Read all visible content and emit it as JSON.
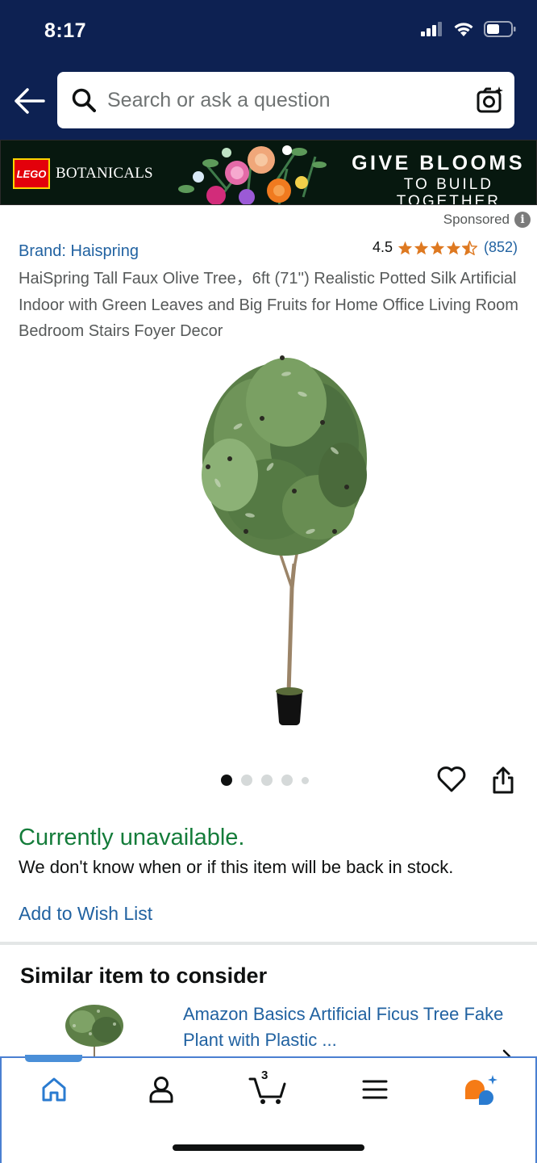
{
  "status_bar": {
    "time": "8:17"
  },
  "header": {
    "search_placeholder": "Search or ask a question"
  },
  "banner": {
    "logo_text": "LEGO",
    "brand": "BOTANICALS",
    "headline": "GIVE BLOOMS",
    "subline_1": "TO BUILD",
    "subline_2": "TOGETHER"
  },
  "product": {
    "sponsored_label": "Sponsored",
    "brand_link": "Brand: Haispring",
    "rating_value": "4.5",
    "rating_stars": 4.5,
    "rating_count": "(852)",
    "title": "HaiSpring Tall Faux Olive Tree，6ft (71'') Realistic Potted Silk Artificial Indoor with Green Leaves and Big Fruits for Home Office Living Room Bedroom Stairs Foyer Decor",
    "image_count": 5,
    "image_active_index": 0
  },
  "availability": {
    "status": "Currently unavailable.",
    "message": "We don't know when or if this item will be back in stock.",
    "wish_list_link": "Add to Wish List"
  },
  "similar": {
    "heading": "Similar item to consider",
    "item_title": "Amazon Basics Artificial Ficus Tree Fake Plant with Plastic ..."
  },
  "bottom_nav": {
    "items": [
      "home-icon",
      "account-icon",
      "cart-icon",
      "menu-icon",
      "rufus-icon"
    ],
    "active": "home-icon",
    "cart_count": "3"
  },
  "colors": {
    "header_bg": "#0d2152",
    "link": "#2162a1",
    "unavailable": "#147c3a",
    "star": "#de7921",
    "nav_accent": "#4a8fd8"
  }
}
